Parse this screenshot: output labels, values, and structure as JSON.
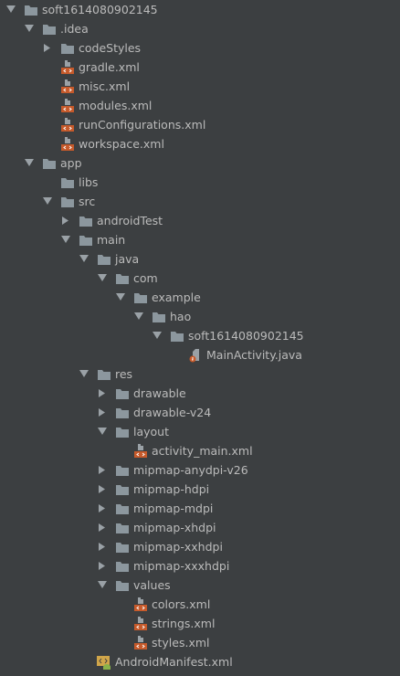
{
  "colors": {
    "background": "#3c3f41",
    "text": "#bbbbbb",
    "folder": "#8c979e",
    "xml": "#c65a2b",
    "java": "#c65a2b",
    "manifest": "#d1a64a",
    "android": "#8ab34a"
  },
  "tree": [
    {
      "depth": 0,
      "type": "folder",
      "expanded": true,
      "label": "soft1614080902145"
    },
    {
      "depth": 1,
      "type": "folder",
      "expanded": true,
      "label": ".idea"
    },
    {
      "depth": 2,
      "type": "folder",
      "expanded": false,
      "label": "codeStyles"
    },
    {
      "depth": 2,
      "type": "xml",
      "label": "gradle.xml"
    },
    {
      "depth": 2,
      "type": "xml",
      "label": "misc.xml"
    },
    {
      "depth": 2,
      "type": "xml",
      "label": "modules.xml"
    },
    {
      "depth": 2,
      "type": "xml",
      "label": "runConfigurations.xml"
    },
    {
      "depth": 2,
      "type": "xml",
      "label": "workspace.xml"
    },
    {
      "depth": 1,
      "type": "folder",
      "expanded": true,
      "label": "app"
    },
    {
      "depth": 2,
      "type": "folder",
      "leaf": true,
      "label": "libs"
    },
    {
      "depth": 2,
      "type": "folder",
      "expanded": true,
      "label": "src"
    },
    {
      "depth": 3,
      "type": "folder",
      "expanded": false,
      "label": "androidTest"
    },
    {
      "depth": 3,
      "type": "folder",
      "expanded": true,
      "label": "main"
    },
    {
      "depth": 4,
      "type": "folder",
      "expanded": true,
      "label": "java"
    },
    {
      "depth": 5,
      "type": "folder",
      "expanded": true,
      "label": "com"
    },
    {
      "depth": 6,
      "type": "folder",
      "expanded": true,
      "label": "example"
    },
    {
      "depth": 7,
      "type": "folder",
      "expanded": true,
      "label": "hao"
    },
    {
      "depth": 8,
      "type": "folder",
      "expanded": true,
      "label": "soft1614080902145"
    },
    {
      "depth": 9,
      "type": "java",
      "label": "MainActivity.java"
    },
    {
      "depth": 4,
      "type": "folder",
      "expanded": true,
      "label": "res"
    },
    {
      "depth": 5,
      "type": "folder",
      "expanded": false,
      "label": "drawable"
    },
    {
      "depth": 5,
      "type": "folder",
      "expanded": false,
      "label": "drawable-v24"
    },
    {
      "depth": 5,
      "type": "folder",
      "expanded": true,
      "label": "layout"
    },
    {
      "depth": 6,
      "type": "xml",
      "label": "activity_main.xml"
    },
    {
      "depth": 5,
      "type": "folder",
      "expanded": false,
      "label": "mipmap-anydpi-v26"
    },
    {
      "depth": 5,
      "type": "folder",
      "expanded": false,
      "label": "mipmap-hdpi"
    },
    {
      "depth": 5,
      "type": "folder",
      "expanded": false,
      "label": "mipmap-mdpi"
    },
    {
      "depth": 5,
      "type": "folder",
      "expanded": false,
      "label": "mipmap-xhdpi"
    },
    {
      "depth": 5,
      "type": "folder",
      "expanded": false,
      "label": "mipmap-xxhdpi"
    },
    {
      "depth": 5,
      "type": "folder",
      "expanded": false,
      "label": "mipmap-xxxhdpi"
    },
    {
      "depth": 5,
      "type": "folder",
      "expanded": true,
      "label": "values"
    },
    {
      "depth": 6,
      "type": "xml",
      "label": "colors.xml"
    },
    {
      "depth": 6,
      "type": "xml",
      "label": "strings.xml"
    },
    {
      "depth": 6,
      "type": "xml",
      "label": "styles.xml"
    },
    {
      "depth": 4,
      "type": "manifest",
      "label": "AndroidManifest.xml"
    }
  ]
}
